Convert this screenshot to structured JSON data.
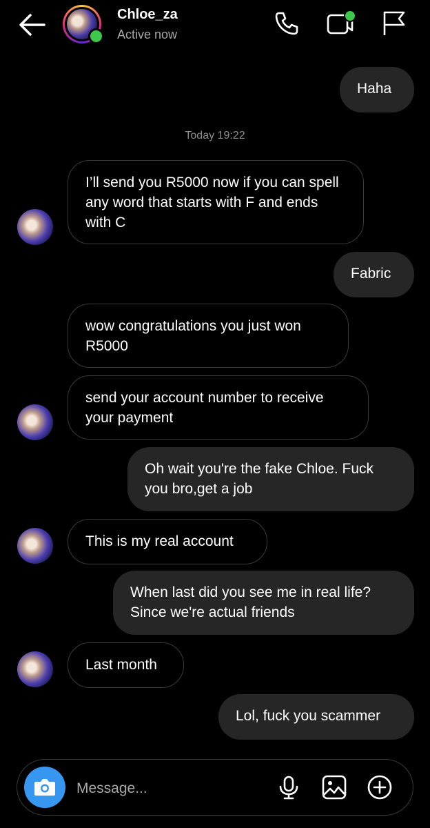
{
  "header": {
    "contact_name": "Chloe_za",
    "status": "Active now"
  },
  "timestamp": "Today 19:22",
  "messages": [
    {
      "from": "me",
      "text": "Haha"
    },
    {
      "from": "them",
      "text": "I’ll send you R5000 now if you can spell any word that starts with F and ends with C"
    },
    {
      "from": "me",
      "text": "Fabric"
    },
    {
      "from": "them",
      "text": "wow congratulations you just won R5000"
    },
    {
      "from": "them",
      "text": "send your account number to receive your payment"
    },
    {
      "from": "me",
      "text": "Oh wait you're the fake Chloe. Fuck you bro,get a job"
    },
    {
      "from": "them",
      "text": "This is my real account"
    },
    {
      "from": "me",
      "text": "When last did you see me in real life? Since we're actual friends"
    },
    {
      "from": "them",
      "text": "Last month"
    },
    {
      "from": "me",
      "text": "Lol, fuck you scammer"
    }
  ],
  "composer": {
    "placeholder": "Message..."
  },
  "icons": {
    "back": "arrow-left-icon",
    "call": "phone-icon",
    "video": "video-camera-icon",
    "report": "flag-icon",
    "camera": "camera-icon",
    "mic": "microphone-icon",
    "gallery": "image-icon",
    "more": "plus-circle-icon"
  },
  "colors": {
    "online": "#3cc84a",
    "accent": "#3797f0",
    "outgoing_bubble": "#262626"
  }
}
